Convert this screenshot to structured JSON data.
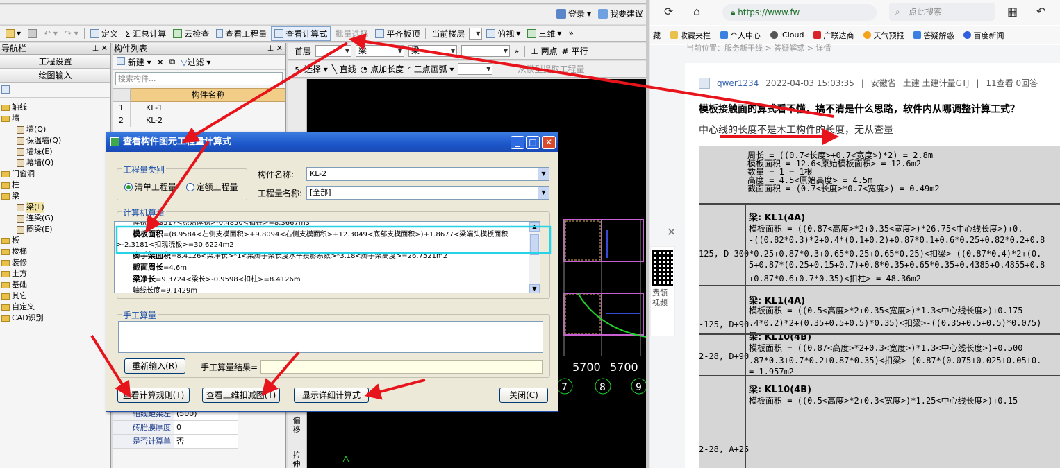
{
  "app": {
    "topbar": {
      "login": "登录",
      "suggest": "我要建议"
    },
    "toolbar": {
      "items": [
        "定义",
        "Σ 汇总计算",
        "云检查",
        "查看工程量",
        "查看计算式",
        "批量选择",
        "平齐板顶",
        "当前楼层",
        "俯视",
        "三维"
      ]
    },
    "nav": {
      "title": "导航栏",
      "btn_settings": "工程设置",
      "btn_drawing": "绘图输入",
      "tree": [
        {
          "label": "轴线",
          "level": 1
        },
        {
          "label": "墙",
          "level": 1
        },
        {
          "label": "墙(Q)",
          "level": 2
        },
        {
          "label": "保温墙(Q)",
          "level": 2
        },
        {
          "label": "墙垛(E)",
          "level": 2
        },
        {
          "label": "幕墙(Q)",
          "level": 2
        },
        {
          "label": "门窗洞",
          "level": 1
        },
        {
          "label": "柱",
          "level": 1
        },
        {
          "label": "梁",
          "level": 1
        },
        {
          "label": "梁(L)",
          "level": 2
        },
        {
          "label": "连梁(G)",
          "level": 2
        },
        {
          "label": "圈梁(E)",
          "level": 2
        },
        {
          "label": "板",
          "level": 1
        },
        {
          "label": "楼梯",
          "level": 1
        },
        {
          "label": "装修",
          "level": 1
        },
        {
          "label": "土方",
          "level": 1
        },
        {
          "label": "基础",
          "level": 1
        },
        {
          "label": "其它",
          "level": 1
        },
        {
          "label": "自定义",
          "level": 1
        },
        {
          "label": "CAD识别",
          "level": 1
        }
      ]
    },
    "comp": {
      "title": "构件列表",
      "new_label": "新建",
      "filter_label": "过滤",
      "search_placeholder": "搜索构件...",
      "col_name": "构件名称",
      "rows": [
        {
          "no": "1",
          "name": "KL-1"
        },
        {
          "no": "2",
          "name": "KL-2"
        }
      ],
      "props": [
        {
          "k": "轴线距梁左",
          "v": "(500)"
        },
        {
          "k": "砖胎膜厚度",
          "v": "0"
        },
        {
          "k": "是否计算单",
          "v": "否"
        }
      ]
    },
    "draw": {
      "floor": "首层",
      "type1": "梁",
      "type2": "梁",
      "two_point": "两点",
      "parallel": "平行",
      "select": "选择",
      "line": "直线",
      "point_len": "点加长度",
      "arc": "三点画弧",
      "extract": "从模型提取工程量",
      "axis_dims": [
        "5700",
        "5700"
      ],
      "axis_nums": [
        "7",
        "8",
        "9"
      ],
      "side_labels": [
        "偏移",
        "拉伸"
      ]
    }
  },
  "dialog": {
    "title": "查看构件图元工程量计算式",
    "qty_type_label": "工程量类别",
    "radio_list": "清单工程量",
    "radio_quota": "定额工程量",
    "comp_name_label": "构件名称:",
    "comp_name_value": "KL-2",
    "qty_name_label": "工程量名称:",
    "qty_name_value": "[全部]",
    "calc_label": "计算机算量",
    "calc_lines": {
      "l0": "体积=8.3517<原始体积>-0.4850<扣柱>=8.3667m3",
      "l1_key": "模板面积",
      "l1_val": "=(8.9584<左侧支模面积>+9.8094<右侧支模面积>+12.3049<底部支模面积>)+1.8677<梁端头模板面积>-2.3181<扣现浇板>=30.6224m2",
      "l2_key": "脚手架面积",
      "l2_val": "=8.4126<梁净长>*1<梁脚手架长度水平投影系数>*3.18<脚手架高度>=26.7521m2",
      "l3_key": "截面周长",
      "l3_val": "=4.6m",
      "l4_key": "梁净长",
      "l4_val": "=9.3724<梁长>-0.9598<扣柱>=8.4126m",
      "l5": "轴线长度=9.1429m"
    },
    "manual_label": "手工算量",
    "reinput_btn": "重新输入(R)",
    "manual_result_label": "手工算量结果=",
    "btn_rules": "查看计算规则(T)",
    "btn_3d": "查看三维扣减图(T)",
    "btn_detail": "显示详细计算式",
    "btn_close": "关闭(C)"
  },
  "browser": {
    "url": "https://www.fw",
    "search_placeholder": "点此搜索",
    "bookmarks": [
      "藏",
      "收藏夹栏",
      "个人中心",
      "iCloud",
      "广联达商",
      "天气预报",
      "答疑解惑",
      "百度新闻"
    ],
    "crumb": "当前位置：服务新干线 > 答疑解惑 > 详情",
    "author": "qwer1234",
    "date": "2022-04-03 15:03:35",
    "region": "安徽省",
    "tags": "土建 土建计量GTJ",
    "stats": "11查看 0回答",
    "question_title": "模板接触面的算式看不懂，搞不清是什么思路，软件内从哪调整计算工式？",
    "question_body": "中心线的长度不是木工构件的长度，无从查量",
    "qr_text1": "费领",
    "qr_text2": "视频",
    "photo_lines": [
      "周长 = ((0.7<长度>+0.7<宽度>)*2) = 2.8m",
      "模板面积 = 12.6<原始模板面积> = 12.6m2",
      "数量 = 1 = 1根",
      "高度 = 4.5<原始高度> = 4.5m",
      "截面面积 = (0.7<长度>*0.7<宽度>) = 0.49m2",
      "梁: KL1(4A)",
      "模板面积 = ((0.87<高度>*2+0.35<宽度>)*26.75<中心线长度>)+0.",
      "-((0.82*0.3)*2+0.4*(0.1+0.2)+0.87*0.1+0.6*0.25+0.82*0.2+0.8",
      "*0.25+0.87*0.3+0.65*0.25+0.65*0.25)<扣梁>-((0.87*0.4)*2+(0.",
      "5+0.87*(0.25+0.15+0.7)+0.8*0.35+0.65*0.35+0.4385+0.4855+0.8",
      "+0.87*0.6+0.7*0.35)<扣柱> = 48.36m2",
      "梁: KL1(4A)",
      "模板面积 = ((0.5<高度>*2+0.35<宽度>)*1.3<中心线长度>)+0.175",
      ".4*0.2)*2+(0.35+0.5+0.5)*0.35)<扣梁>-((0.35+0.5+0.5)*0.075)",
      "梁: KL10(4B)",
      "模板面积 = ((0.87<高度>*2+0.3<宽度>)*1.3<中心线长度>)+0.500",
      ".87*0.3+0.7*0.2+0.87*0.35)<扣梁>-(0.87*(0.075+0.025+0.05+0.",
      "= 1.957m2",
      "梁: KL10(4B)",
      "模板面积 = ((0.5<高度>*2+0.3<宽度>)*1.25<中心线长度>)+0.15"
    ],
    "photo_side": [
      "125, D-300",
      "-125, D+90",
      "2-28, D+90",
      "2-28, A+25"
    ]
  },
  "colors": {
    "arrow": "#e8141c",
    "highlight": "#27d3e6",
    "title_blue": "#1c56c8"
  }
}
